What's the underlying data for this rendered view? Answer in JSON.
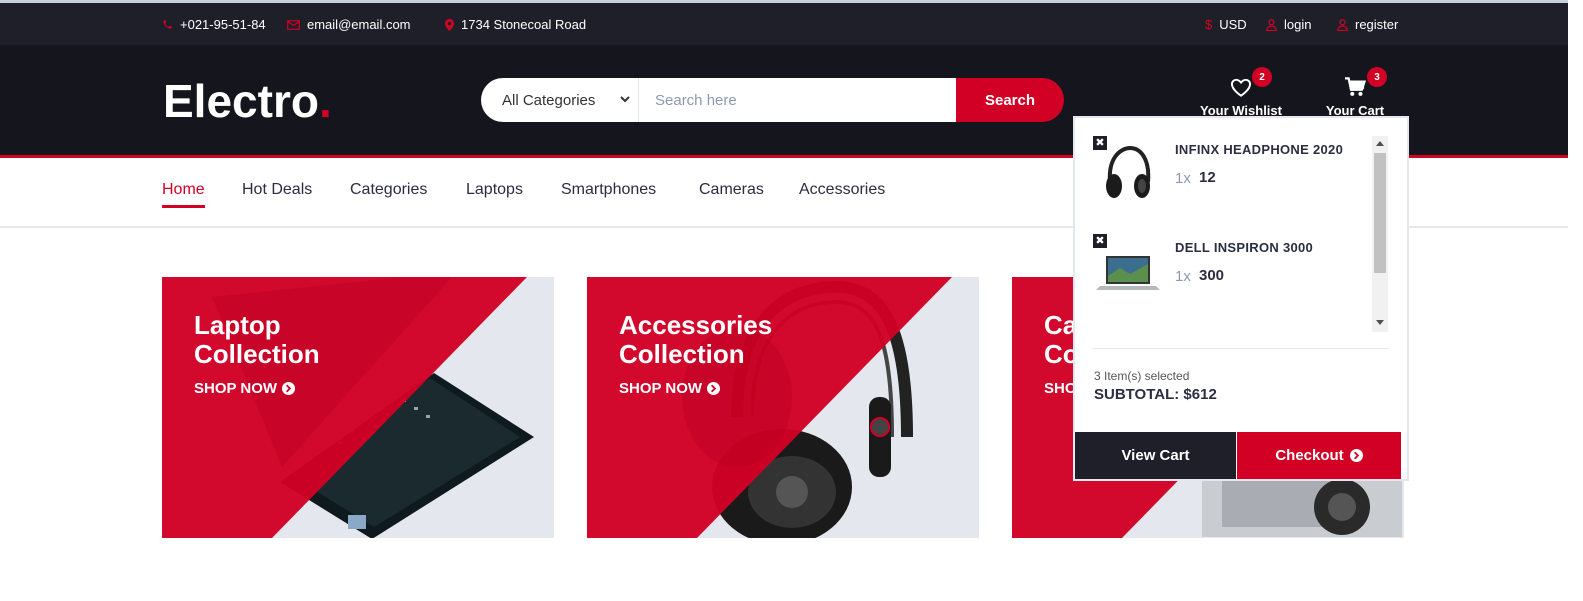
{
  "topbar": {
    "phone": "+021-95-51-84",
    "email": "email@email.com",
    "address": "1734 Stonecoal Road",
    "currency": "USD",
    "login": "login",
    "register": "register"
  },
  "header": {
    "logo_text": "Electro",
    "logo_dot": ".",
    "category_selected": "All Categories",
    "search_placeholder": "Search here",
    "search_button": "Search",
    "wishlist_label": "Your Wishlist",
    "wishlist_count": "2",
    "cart_label": "Your Cart",
    "cart_count": "3"
  },
  "nav": {
    "items": [
      {
        "label": "Home",
        "active": true
      },
      {
        "label": "Hot Deals"
      },
      {
        "label": "Categories"
      },
      {
        "label": "Laptops"
      },
      {
        "label": "Smartphones"
      },
      {
        "label": "Cameras"
      },
      {
        "label": "Accessories"
      }
    ]
  },
  "collections": [
    {
      "title_line1": "Laptop",
      "title_line2": "Collection",
      "cta": "SHOP NOW"
    },
    {
      "title_line1": "Accessories",
      "title_line2": "Collection",
      "cta": "SHOP NOW"
    },
    {
      "title_line1": "Cameras",
      "title_line2": "Collection",
      "cta": "SHOP NOW"
    }
  ],
  "cart_dropdown": {
    "items": [
      {
        "name": "INFINX HEADPHONE 2020",
        "qty": "1x",
        "price": "12"
      },
      {
        "name": "DELL INSPIRON 3000",
        "qty": "1x",
        "price": "300"
      }
    ],
    "items_selected": "3 Item(s) selected",
    "subtotal": "SUBTOTAL: $612",
    "view_cart": "View Cart",
    "checkout": "Checkout"
  },
  "colors": {
    "brand_red": "#D10024",
    "dark": "#15161D",
    "topbar": "#1E1F29",
    "text": "#2B2D42"
  }
}
